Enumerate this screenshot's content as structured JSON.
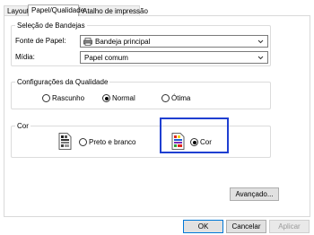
{
  "tabs": [
    {
      "label": "Layout"
    },
    {
      "label": "Papel/Qualidade"
    },
    {
      "label": "Atalho de impressão"
    }
  ],
  "tray_group": {
    "title": "Seleção de Bandejas",
    "source_label": "Fonte de Papel:",
    "source_value": "Bandeja principal",
    "media_label": "Mídia:",
    "media_value": "Papel comum"
  },
  "quality_group": {
    "title": "Configurações da Qualidade",
    "options": [
      {
        "label": "Rascunho",
        "checked": false
      },
      {
        "label": "Normal",
        "checked": true
      },
      {
        "label": "Ótima",
        "checked": false
      }
    ]
  },
  "color_group": {
    "title": "Cor",
    "options": [
      {
        "label": "Preto e branco",
        "checked": false,
        "icon": "grayscale-document-icon"
      },
      {
        "label": "Cor",
        "checked": true,
        "icon": "color-document-icon"
      }
    ]
  },
  "buttons": {
    "advanced": "Avançado...",
    "ok": "OK",
    "cancel": "Cancelar",
    "apply": "Aplicar"
  },
  "colors": {
    "focus_border": "#1f3fd1",
    "default_button_border": "#0078d7"
  }
}
